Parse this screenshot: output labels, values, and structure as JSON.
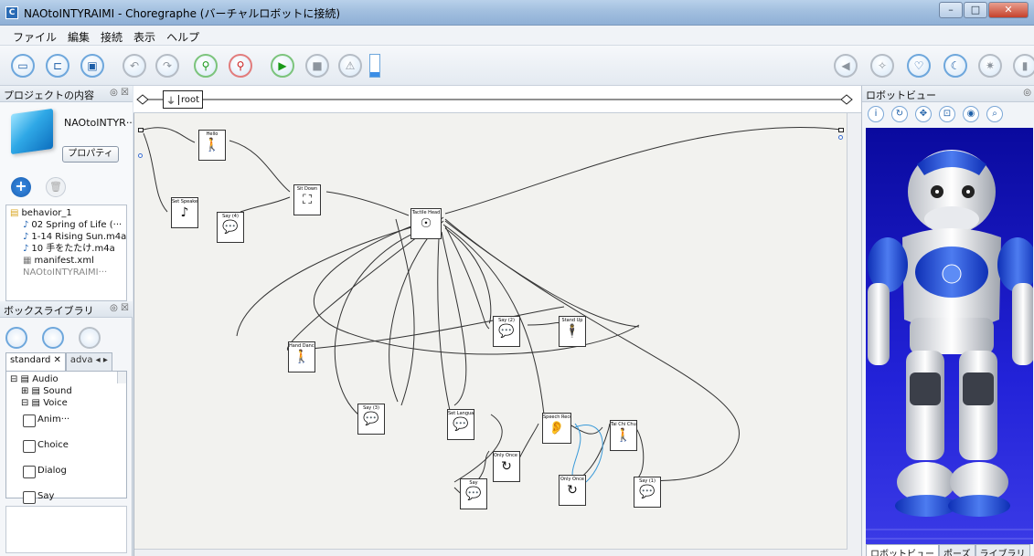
{
  "window": {
    "title": "NAOtoINTYRAIMI - Choregraphe (バーチャルロボットに接続)",
    "app_icon": "C"
  },
  "menu": [
    "ファイル",
    "編集",
    "接続",
    "表示",
    "ヘルプ"
  ],
  "project_panel": {
    "title": "プロジェクトの内容",
    "project_name": "NAOtoINTYR···",
    "properties_button": "プロパティ",
    "tree": [
      {
        "label": "behavior_1",
        "kind": "folder",
        "indent": 0
      },
      {
        "label": "02 Spring of Life (···",
        "kind": "file",
        "indent": 1
      },
      {
        "label": "1-14 Rising Sun.m4a",
        "kind": "file",
        "indent": 1
      },
      {
        "label": "10 手をたたけ.m4a",
        "kind": "file",
        "indent": 1
      },
      {
        "label": "manifest.xml",
        "kind": "xml",
        "indent": 1
      },
      {
        "label": "NAOtoINTYRAIMI···",
        "kind": "grey",
        "indent": 1
      }
    ]
  },
  "box_library": {
    "title": "ボックスライブラリ",
    "tabs": [
      "standard",
      "adva"
    ],
    "tree": [
      {
        "label": "Audio",
        "indent": 0
      },
      {
        "label": "Sound",
        "indent": 1
      },
      {
        "label": "Voice",
        "indent": 1
      }
    ],
    "items": [
      "Anim···",
      "Choice",
      "Dialog",
      "Say"
    ]
  },
  "canvas": {
    "breadcrumb": "root",
    "boxes": [
      {
        "id": "hello",
        "name": "Hello",
        "icon": "🚶"
      },
      {
        "id": "setspeaker",
        "name": "Set Speaker Vol.",
        "icon": "♪"
      },
      {
        "id": "say4",
        "name": "Say (4)",
        "icon": "💬"
      },
      {
        "id": "sitdown",
        "name": "Sit Down",
        "icon": "⛶"
      },
      {
        "id": "tactile",
        "name": "Tactile Head",
        "icon": "☉"
      },
      {
        "id": "say2",
        "name": "Say (2)",
        "icon": "💬"
      },
      {
        "id": "standup",
        "name": "Stand Up",
        "icon": "🕴"
      },
      {
        "id": "handdance",
        "name": "Hand Dance",
        "icon": "🚶"
      },
      {
        "id": "say3",
        "name": "Say (3)",
        "icon": "💬"
      },
      {
        "id": "setlang",
        "name": "Set Language",
        "icon": "💬"
      },
      {
        "id": "speechreco",
        "name": "Speech Reco.",
        "icon": "👂"
      },
      {
        "id": "tailchase",
        "name": "Tai Chi Chuan",
        "icon": "🚶"
      },
      {
        "id": "onlyonce2",
        "name": "Only Once (2)",
        "icon": "↻"
      },
      {
        "id": "onlyonce",
        "name": "Only Once",
        "icon": "↻"
      },
      {
        "id": "say",
        "name": "Say",
        "icon": "💬"
      },
      {
        "id": "say1",
        "name": "Say (1)",
        "icon": "💬"
      }
    ]
  },
  "robot_panel": {
    "title": "ロボットビュー",
    "tabs": [
      "ロボットビュー",
      "ポーズ",
      "ライブラリ"
    ]
  }
}
